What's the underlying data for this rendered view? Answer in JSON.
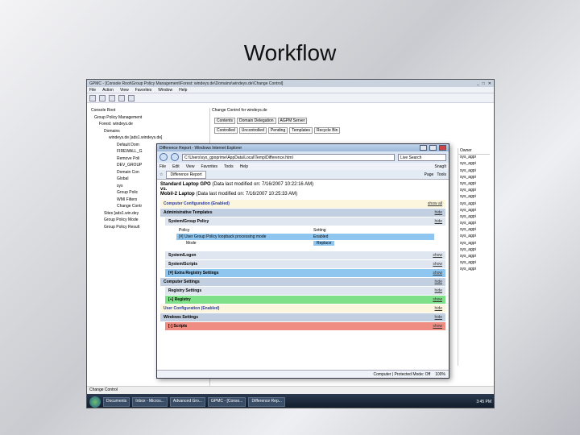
{
  "slide_title": "Workflow",
  "mmc": {
    "title": "GPMC - [Console Root\\Group Policy Management\\Forest: windeys.de\\Domains\\windeys.de\\Change Control]",
    "menu": [
      "File",
      "Action",
      "View",
      "Favorites",
      "Window",
      "Help"
    ],
    "tree": [
      "Console Root",
      "Group Policy Management",
      "Forest: windeys.de",
      "Domains",
      "windeys.de [ads1.windeys.de]",
      "Default Dom",
      "FIREWALL_G",
      "Remove Poli",
      "DEV_GROUP",
      "Domain Con",
      "Global",
      "sys",
      "Group Polic",
      "WMI Filters",
      "Change Contr",
      "Sites [ads1.win.dey",
      "Group Policy Mode",
      "Group Policy Result"
    ],
    "right_header": "Change Control for windeys.de",
    "right_tabs": [
      "Contents",
      "Domain Delegation",
      "AGPM Server"
    ],
    "sub_tabs": [
      "Controlled",
      "Uncontrolled",
      "Pending",
      "Templates",
      "Recycle Bin"
    ],
    "owner_header": "Owner",
    "owner_rows": [
      "sys_agpi",
      "sys_agpi",
      "sys_agpi",
      "sys_agpi",
      "sys_agpi",
      "sys_agpi",
      "sys_agpi",
      "sys_agpi",
      "sys_agpi",
      "sys_agpi",
      "sys_agpi",
      "sys_agpi",
      "sys_agpi",
      "sys_agpi",
      "sys_agpi",
      "sys_agpi",
      "sys_agpi",
      "sys_agpi"
    ],
    "status_bar": "Change Control"
  },
  "ie": {
    "title": "Difference Report - Windows Internet Explorer",
    "address": "C:\\Users\\sys_gpoprime\\AppData\\Local\\Temp\\Difference.html",
    "search_placeholder": "Live Search",
    "menu": [
      "File",
      "Edit",
      "View",
      "Favorites",
      "Tools",
      "Help"
    ],
    "snag": "SnagIt",
    "tab_label": "Difference Report",
    "page_label": "Page",
    "tools_label": "Tools",
    "status_computer": "Computer | Protected Mode: Off",
    "zoom": "100%"
  },
  "report": {
    "gpo1": "Standard Laptop GPO",
    "gpo1_meta": "(Data last modified on: 7/16/2007 10:22:16 AM)",
    "vs": "vs.",
    "gpo2": "Mobil-2 Laptop",
    "gpo2_meta": "(Data last modified on: 7/16/2007 10:25:33 AM)",
    "computer_config": "Computer Configuration (Enabled)",
    "show_all": "show all",
    "admin_templates": "Administrative Templates",
    "system_group_policy": "System/Group Policy",
    "hide": "hide",
    "show": "show",
    "policy_header": "Policy",
    "setting_header": "Setting",
    "policy_row": "[#] User Group Policy loopback processing mode",
    "policy_value": "Enabled",
    "mode_label": "Mode",
    "mode_value": "Replace",
    "system_logon": "System/Logon",
    "system_scripts": "System/Scripts",
    "extra_registry": "[#] Extra Registry Settings",
    "computer_settings": "Computer Settings",
    "registry_settings": "Registry Settings",
    "registry_added": "[+] Registry",
    "user_config": "User Configuration (Enabled)",
    "windows_settings": "Windows Settings",
    "scripts_removed": "[-] Scripts"
  },
  "taskbar": {
    "items": [
      "Documents",
      "Inbox - Micros...",
      "Advanced Gro...",
      "GPMC - [Conso...",
      "Difference Rep..."
    ],
    "clock": "3:45 PM"
  }
}
